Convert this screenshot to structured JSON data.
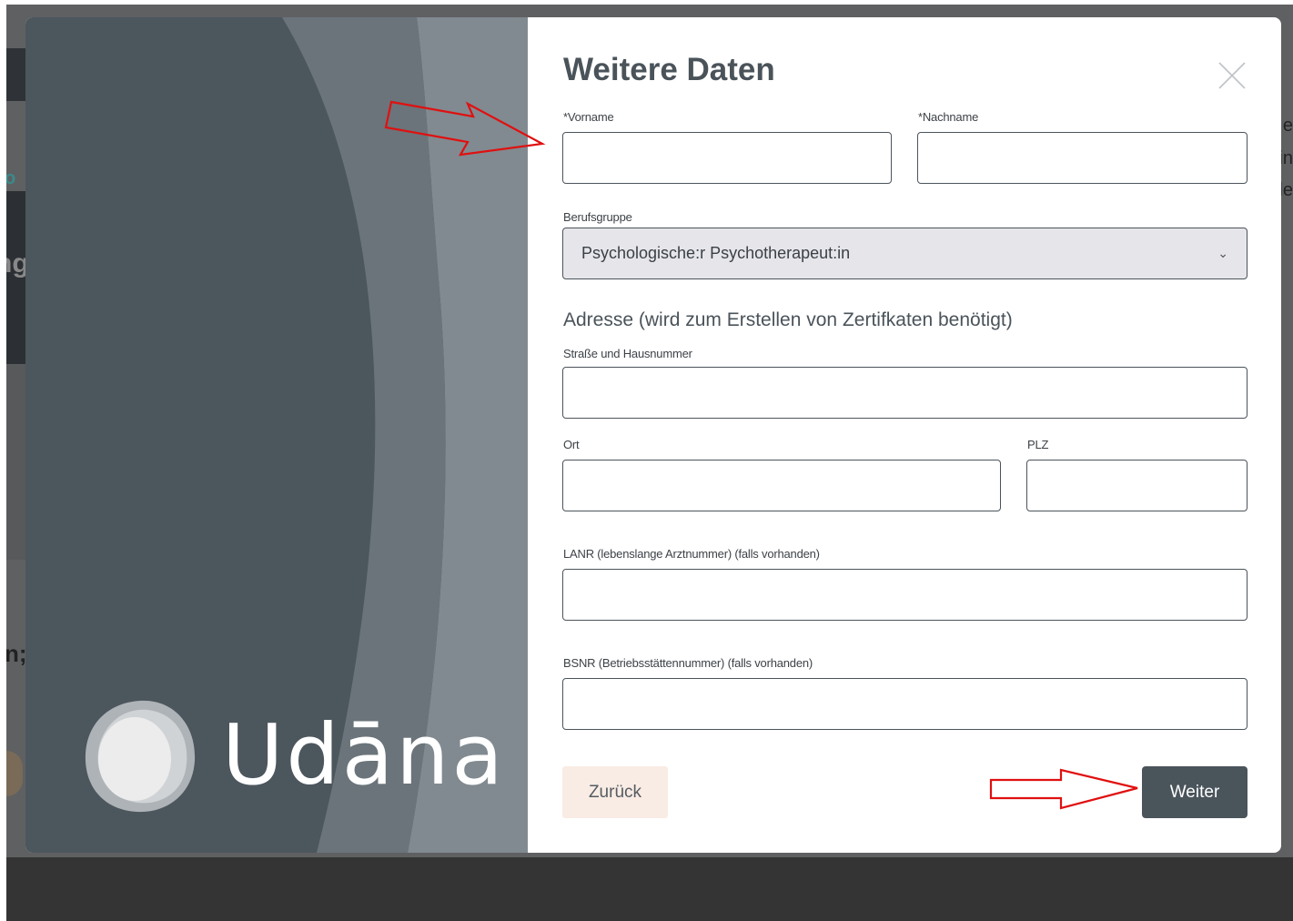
{
  "background": {
    "partial_texts": [
      "o",
      "ng",
      "n;"
    ],
    "right_partial": [
      "e",
      "in",
      "le"
    ]
  },
  "logo": {
    "text": "Udāna"
  },
  "modal": {
    "title": "Weitere Daten",
    "fields": {
      "vorname": {
        "label": "*Vorname",
        "value": ""
      },
      "nachname": {
        "label": "*Nachname",
        "value": ""
      },
      "berufsgruppe": {
        "label": "Berufsgruppe",
        "selected": "Psychologische:r Psychotherapeut:in"
      },
      "strasse": {
        "label": "Straße und Hausnummer",
        "value": ""
      },
      "ort": {
        "label": "Ort",
        "value": ""
      },
      "plz": {
        "label": "PLZ",
        "value": ""
      },
      "lanr": {
        "label": "LANR (lebenslange Arztnummer) (falls vorhanden)",
        "value": ""
      },
      "bsnr": {
        "label": "BSNR (Betriebsstättennummer) (falls vorhanden)",
        "value": ""
      }
    },
    "address_heading": "Adresse (wird zum Erstellen von Zertifkaten benötigt)",
    "buttons": {
      "back": "Zurück",
      "next": "Weiter"
    }
  },
  "colors": {
    "modal_left_bg": "#4c565d",
    "primary_button": "#4a545b",
    "back_button": "#f9ece4",
    "annotation_arrow": "#e01010"
  },
  "icons": [
    "close-icon",
    "chevron-down-icon",
    "udana-logo-icon",
    "annotation-arrow-icon"
  ]
}
